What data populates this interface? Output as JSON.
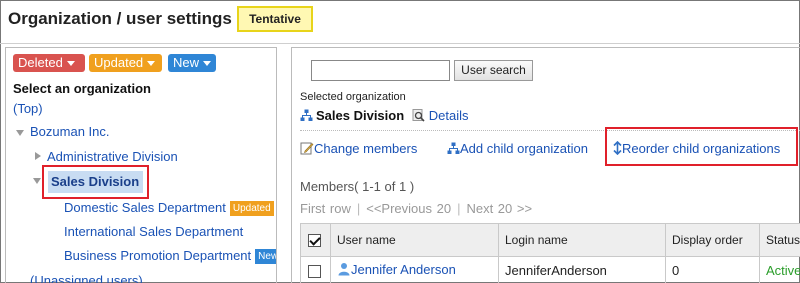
{
  "header": {
    "title": "Organization / user settings",
    "status_badge": "Tentative"
  },
  "left": {
    "filters": {
      "deleted": "Deleted",
      "updated": "Updated",
      "new": "New"
    },
    "select_title": "Select an organization",
    "top_link": "(Top)",
    "tree": {
      "root": "Bozuman Inc.",
      "administrative": "Administrative Division",
      "sales": "Sales Division",
      "domestic": "Domestic Sales Department",
      "domestic_badge": "Updated",
      "international": "International Sales Department",
      "business": "Business Promotion Department",
      "business_badge": "New",
      "unassigned": "(Unassigned users)"
    }
  },
  "right": {
    "search": {
      "value": "",
      "button": "User search"
    },
    "selected_label": "Selected organization",
    "selected_name": "Sales Division",
    "details_link": "Details",
    "actions": {
      "change_members": "Change members",
      "add_child": "Add child organization",
      "reorder": "Reorder child organizations"
    },
    "members_title": "Members( 1-1 of 1 )",
    "pager": {
      "first": "First row",
      "prev": "<<Previous 20",
      "next": "Next 20 >>"
    },
    "table": {
      "headers": [
        "User name",
        "Login name",
        "Display order",
        "Status"
      ],
      "rows": [
        {
          "user_name": "Jennifer Anderson",
          "login_name": "JenniferAnderson",
          "display_order": "0",
          "status": "Active"
        }
      ]
    }
  },
  "colors": {
    "link": "#1a52b5",
    "highlight_border": "#e0202a",
    "deleted": "#d9534f",
    "updated": "#f0a01e",
    "new": "#2f86d6",
    "active": "#2a9d2a"
  }
}
